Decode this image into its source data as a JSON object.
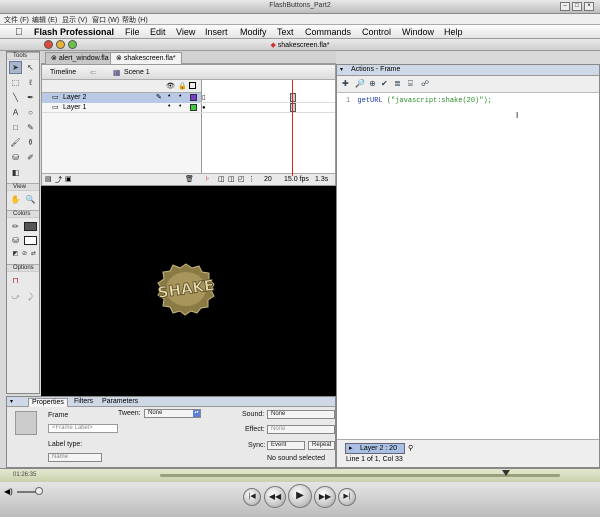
{
  "player": {
    "title": "FlashButtons_Part2",
    "menu": [
      "文件 (F)",
      "编辑 (E)",
      "显示 (V)",
      "窗口 (W)",
      "帮助 (H)"
    ],
    "time": "01:26:35"
  },
  "menubar": {
    "app": "Flash Professional",
    "items": [
      "File",
      "Edit",
      "View",
      "Insert",
      "Modify",
      "Text",
      "Commands",
      "Control",
      "Window",
      "Help"
    ]
  },
  "document": {
    "title": "shakescreen.fla*"
  },
  "tools": {
    "header": "Tools",
    "view_header": "View",
    "colors_header": "Colors",
    "options_header": "Options"
  },
  "tabs": [
    "alert_window.fla",
    "shakescreen.fla*"
  ],
  "timeline": {
    "label": "Timeline",
    "scene": "Scene 1",
    "frame_numbers": [
      "1",
      "5",
      "10",
      "15",
      "20",
      "25"
    ],
    "layers": [
      {
        "name": "Layer 2",
        "selected": true,
        "color": "#7a3ccc"
      },
      {
        "name": "Layer 1",
        "selected": false,
        "color": "#3ccc3c"
      }
    ],
    "status": {
      "frame": "20",
      "fps": "15.0 fps",
      "time": "1.3s"
    }
  },
  "stage": {
    "logo_text": "SHAKE"
  },
  "properties": {
    "tabs": [
      "Properties",
      "Filters",
      "Parameters"
    ],
    "frame_label": "Frame",
    "frame_placeholder": "<Frame Label>",
    "label_type_label": "Label type:",
    "label_type_value": "Name",
    "tween_label": "Tween:",
    "tween_value": "None",
    "sound_label": "Sound:",
    "sound_value": "None",
    "effect_label": "Effect:",
    "effect_value": "None",
    "sync_label": "Sync:",
    "sync_value": "Event",
    "repeat_value": "Repeat",
    "no_sound": "No sound selected"
  },
  "actions": {
    "title": "Actions - Frame",
    "line_number": "1",
    "code_fn": "getURL",
    "code_str": "(\"javascript:shake(20)\");",
    "layer_tab": "Layer 2 : 20",
    "status": "Line 1 of 1, Col 33"
  },
  "colors": {
    "accent": "#5b7ed6",
    "stage": "#000000",
    "playhead": "#dd2222"
  }
}
